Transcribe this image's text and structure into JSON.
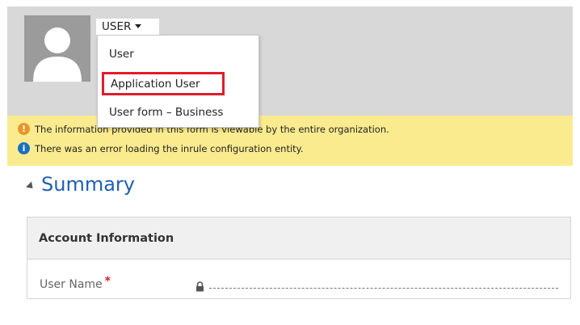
{
  "header": {
    "form_selector_label": "USER",
    "avatar_icon": "user-silhouette-icon"
  },
  "form_menu": {
    "items": [
      {
        "label": "User",
        "highlighted": false
      },
      {
        "label": "Application User",
        "highlighted": true
      },
      {
        "label": "User form – Business",
        "highlighted": false
      }
    ],
    "highlight_color": "#e01d2b"
  },
  "notifications": [
    {
      "icon": "warning-icon",
      "text": "The information provided in this form is viewable by the entire organization."
    },
    {
      "icon": "info-icon",
      "text": "There was an error loading the inrule configuration entity."
    }
  ],
  "summary": {
    "title": "Summary"
  },
  "account_section": {
    "header": "Account Information",
    "fields": [
      {
        "label": "User Name",
        "required_mark": "*",
        "value": "",
        "locked": true
      }
    ]
  },
  "colors": {
    "header_band": "#d8d8d8",
    "notice_bar": "#fbeb8f",
    "summary_link": "#1f5fb3",
    "warning": "#e8962a",
    "info": "#1a6fc1",
    "required": "#cc2222"
  }
}
